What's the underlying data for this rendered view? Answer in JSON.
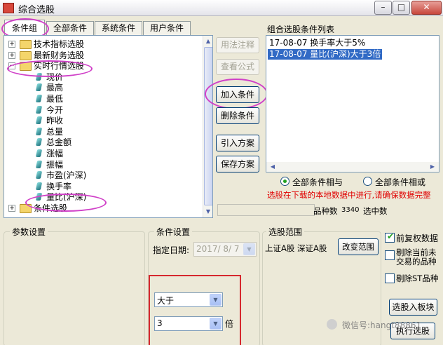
{
  "window": {
    "title": "综合选股"
  },
  "tabs": [
    {
      "label": "条件组"
    },
    {
      "label": "全部条件"
    },
    {
      "label": "系统条件"
    },
    {
      "label": "用户条件"
    }
  ],
  "tree": {
    "nodes": [
      {
        "label": "技术指标选股",
        "type": "folder"
      },
      {
        "label": "最新财务选股",
        "type": "folder"
      },
      {
        "label": "实时行情选股",
        "type": "folder"
      },
      {
        "label": "现价",
        "type": "leaf"
      },
      {
        "label": "最高",
        "type": "leaf"
      },
      {
        "label": "最低",
        "type": "leaf"
      },
      {
        "label": "今开",
        "type": "leaf"
      },
      {
        "label": "昨收",
        "type": "leaf"
      },
      {
        "label": "总量",
        "type": "leaf"
      },
      {
        "label": "总金额",
        "type": "leaf"
      },
      {
        "label": "涨幅",
        "type": "leaf"
      },
      {
        "label": "振幅",
        "type": "leaf"
      },
      {
        "label": "市盈(沪深)",
        "type": "leaf"
      },
      {
        "label": "换手率",
        "type": "leaf"
      },
      {
        "label": "量比(沪深)",
        "type": "leaf"
      },
      {
        "label": "条件选股",
        "type": "folder"
      }
    ]
  },
  "actions": {
    "usage_note": "用法注释",
    "view_formula": "查看公式",
    "add_condition": "加入条件",
    "delete_condition": "删除条件",
    "import_plan": "引入方案",
    "save_plan": "保存方案"
  },
  "condition_list": {
    "title": "组合选股条件列表",
    "items": [
      {
        "text": "17-08-07  换手率大于5%",
        "selected": false
      },
      {
        "text": "17-08-07  量比(沪深)大于3倍",
        "selected": true
      }
    ]
  },
  "logic": {
    "and_label": "全部条件相与",
    "or_label": "全部条件相或",
    "selected": "and"
  },
  "warning": "选股在下载的本地数据中进行,请确保数据完整",
  "stats": {
    "variety_label": "品种数",
    "variety_value": "3340",
    "selected_label": "选中数",
    "selected_value": ""
  },
  "params": {
    "title": "参数设置"
  },
  "condition_settings": {
    "title": "条件设置",
    "date_label": "指定日期:",
    "date_value": "2017/ 8/ 7",
    "operator": "大于",
    "value": "3",
    "unit": "倍"
  },
  "range": {
    "title": "选股范围",
    "value": "上证A股  深证A股",
    "change_button": "改变范围"
  },
  "options": {
    "adjust_label": "前复权数据",
    "adjust_checked": true,
    "exclude_suspended_label": "剔除当前未交易的品种",
    "exclude_suspended_checked": false,
    "exclude_st_label": "剔除ST品种",
    "exclude_st_checked": false
  },
  "bottom_buttons": {
    "to_board": "选股入板块",
    "execute": "执行选股"
  },
  "watermark": "微信号:hangt88861",
  "colors": {
    "highlight": "#316ac5",
    "annotation_circle": "#d040c8",
    "annotation_box": "#d6282e",
    "warning": "#e00000"
  }
}
